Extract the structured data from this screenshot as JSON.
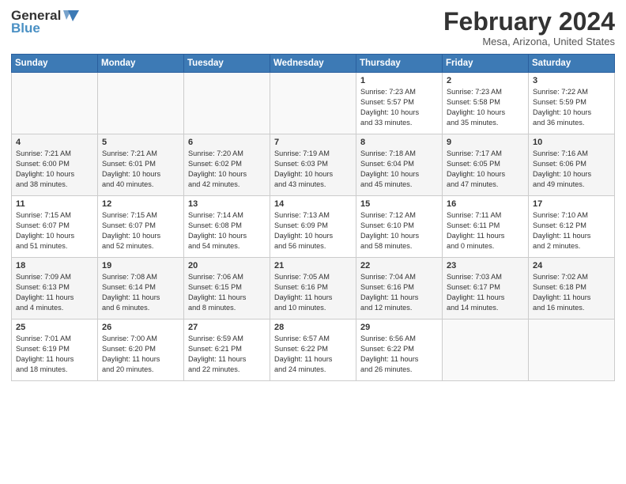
{
  "app": {
    "logo_general": "General",
    "logo_blue": "Blue"
  },
  "header": {
    "month": "February 2024",
    "location": "Mesa, Arizona, United States"
  },
  "weekdays": [
    "Sunday",
    "Monday",
    "Tuesday",
    "Wednesday",
    "Thursday",
    "Friday",
    "Saturday"
  ],
  "weeks": [
    [
      {
        "day": "",
        "info": ""
      },
      {
        "day": "",
        "info": ""
      },
      {
        "day": "",
        "info": ""
      },
      {
        "day": "",
        "info": ""
      },
      {
        "day": "1",
        "info": "Sunrise: 7:23 AM\nSunset: 5:57 PM\nDaylight: 10 hours\nand 33 minutes."
      },
      {
        "day": "2",
        "info": "Sunrise: 7:23 AM\nSunset: 5:58 PM\nDaylight: 10 hours\nand 35 minutes."
      },
      {
        "day": "3",
        "info": "Sunrise: 7:22 AM\nSunset: 5:59 PM\nDaylight: 10 hours\nand 36 minutes."
      }
    ],
    [
      {
        "day": "4",
        "info": "Sunrise: 7:21 AM\nSunset: 6:00 PM\nDaylight: 10 hours\nand 38 minutes."
      },
      {
        "day": "5",
        "info": "Sunrise: 7:21 AM\nSunset: 6:01 PM\nDaylight: 10 hours\nand 40 minutes."
      },
      {
        "day": "6",
        "info": "Sunrise: 7:20 AM\nSunset: 6:02 PM\nDaylight: 10 hours\nand 42 minutes."
      },
      {
        "day": "7",
        "info": "Sunrise: 7:19 AM\nSunset: 6:03 PM\nDaylight: 10 hours\nand 43 minutes."
      },
      {
        "day": "8",
        "info": "Sunrise: 7:18 AM\nSunset: 6:04 PM\nDaylight: 10 hours\nand 45 minutes."
      },
      {
        "day": "9",
        "info": "Sunrise: 7:17 AM\nSunset: 6:05 PM\nDaylight: 10 hours\nand 47 minutes."
      },
      {
        "day": "10",
        "info": "Sunrise: 7:16 AM\nSunset: 6:06 PM\nDaylight: 10 hours\nand 49 minutes."
      }
    ],
    [
      {
        "day": "11",
        "info": "Sunrise: 7:15 AM\nSunset: 6:07 PM\nDaylight: 10 hours\nand 51 minutes."
      },
      {
        "day": "12",
        "info": "Sunrise: 7:15 AM\nSunset: 6:07 PM\nDaylight: 10 hours\nand 52 minutes."
      },
      {
        "day": "13",
        "info": "Sunrise: 7:14 AM\nSunset: 6:08 PM\nDaylight: 10 hours\nand 54 minutes."
      },
      {
        "day": "14",
        "info": "Sunrise: 7:13 AM\nSunset: 6:09 PM\nDaylight: 10 hours\nand 56 minutes."
      },
      {
        "day": "15",
        "info": "Sunrise: 7:12 AM\nSunset: 6:10 PM\nDaylight: 10 hours\nand 58 minutes."
      },
      {
        "day": "16",
        "info": "Sunrise: 7:11 AM\nSunset: 6:11 PM\nDaylight: 11 hours\nand 0 minutes."
      },
      {
        "day": "17",
        "info": "Sunrise: 7:10 AM\nSunset: 6:12 PM\nDaylight: 11 hours\nand 2 minutes."
      }
    ],
    [
      {
        "day": "18",
        "info": "Sunrise: 7:09 AM\nSunset: 6:13 PM\nDaylight: 11 hours\nand 4 minutes."
      },
      {
        "day": "19",
        "info": "Sunrise: 7:08 AM\nSunset: 6:14 PM\nDaylight: 11 hours\nand 6 minutes."
      },
      {
        "day": "20",
        "info": "Sunrise: 7:06 AM\nSunset: 6:15 PM\nDaylight: 11 hours\nand 8 minutes."
      },
      {
        "day": "21",
        "info": "Sunrise: 7:05 AM\nSunset: 6:16 PM\nDaylight: 11 hours\nand 10 minutes."
      },
      {
        "day": "22",
        "info": "Sunrise: 7:04 AM\nSunset: 6:16 PM\nDaylight: 11 hours\nand 12 minutes."
      },
      {
        "day": "23",
        "info": "Sunrise: 7:03 AM\nSunset: 6:17 PM\nDaylight: 11 hours\nand 14 minutes."
      },
      {
        "day": "24",
        "info": "Sunrise: 7:02 AM\nSunset: 6:18 PM\nDaylight: 11 hours\nand 16 minutes."
      }
    ],
    [
      {
        "day": "25",
        "info": "Sunrise: 7:01 AM\nSunset: 6:19 PM\nDaylight: 11 hours\nand 18 minutes."
      },
      {
        "day": "26",
        "info": "Sunrise: 7:00 AM\nSunset: 6:20 PM\nDaylight: 11 hours\nand 20 minutes."
      },
      {
        "day": "27",
        "info": "Sunrise: 6:59 AM\nSunset: 6:21 PM\nDaylight: 11 hours\nand 22 minutes."
      },
      {
        "day": "28",
        "info": "Sunrise: 6:57 AM\nSunset: 6:22 PM\nDaylight: 11 hours\nand 24 minutes."
      },
      {
        "day": "29",
        "info": "Sunrise: 6:56 AM\nSunset: 6:22 PM\nDaylight: 11 hours\nand 26 minutes."
      },
      {
        "day": "",
        "info": ""
      },
      {
        "day": "",
        "info": ""
      }
    ]
  ]
}
